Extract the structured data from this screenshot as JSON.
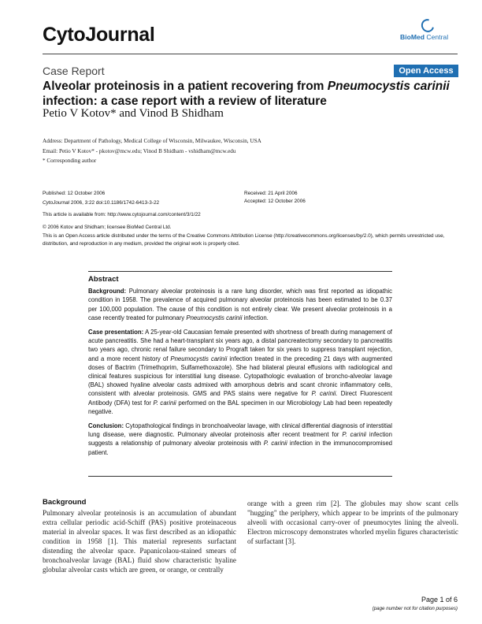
{
  "header": {
    "journal_name": "CytoJournal",
    "publisher_logo": {
      "bold": "BioMed",
      "normal": " Central",
      "icon": "biomed-ring-icon"
    }
  },
  "article": {
    "type": "Case Report",
    "open_access": "Open Access",
    "title_part1": "Alveolar proteinosis in a patient recovering from ",
    "title_italic1": "Pneumocystis carinii",
    "title_part2": " infection: a case report with a review of literature",
    "authors": "Petio V Kotov* and Vinod B Shidham",
    "address": "Address: Department of Pathology, Medical College of Wisconsin, Milwaukee, Wisconsin, USA",
    "email": "Email: Petio V Kotov* - pkotov@mcw.edu; Vinod B Shidham - vshidham@mcw.edu",
    "corresponding": "* Corresponding author"
  },
  "meta": {
    "published": "Published: 12 October 2006",
    "citation_journal": "CytoJournal",
    "citation_rest": " 2006, 3:22    doi:10.1186/1742-6413-3-22",
    "received": "Received: 21 April 2006",
    "accepted": "Accepted: 12 October 2006",
    "available": "This article is available from: http://www.cytojournal.com/content/3/1/22",
    "copyright": "© 2006 Kotov and Shidham; licensee BioMed Central Ltd.",
    "license": "This is an Open Access article distributed under the terms of the Creative Commons Attribution License (http://creativecommons.org/licenses/by/2.0), which permits unrestricted use, distribution, and reproduction in any medium, provided the original work is properly cited."
  },
  "abstract": {
    "heading": "Abstract",
    "background_label": "Background:",
    "background_text": " Pulmonary alveolar proteinosis is a rare lung disorder, which was first reported as idiopathic condition in 1958. The prevalence of acquired pulmonary alveolar proteinosis has been estimated to be 0.37 per 100,000 population. The cause of this condition is not entirely clear. We present alveolar proteinosis in a case recently treated for pulmonary ",
    "background_italic": "Pneumocystis carinii",
    "background_end": " infection.",
    "case_label": "Case presentation:",
    "case_text1": " A 25-year-old Caucasian female presented with shortness of breath during management of acute pancreatitis. She had a heart-transplant six years ago, a distal pancreatectomy secondary to pancreatitis two years ago, chronic renal failure secondary to Prograft taken for six years to suppress transplant rejection, and a more recent history of ",
    "case_italic1": "Pneumocystis carinii",
    "case_text2": " infection treated in the preceding 21 days with augmented doses of Bactrim (Trimethoprim, Sulfamethoxazole). She had bilateral pleural effusions with radiological and clinical features suspicious for interstitial lung disease. Cytopathologic evaluation of broncho-alveolar lavage (BAL) showed hyaline alveolar casts admixed with amorphous debris and scant chronic inflammatory cells, consistent with alveolar proteinosis. GMS and PAS stains were negative for ",
    "case_italic2": "P. carinii.",
    "case_text3": " Direct Fluorescent Antibody (DFA) test for ",
    "case_italic3": "P. carinii",
    "case_text4": " performed on the BAL specimen in our Microbiology Lab had been repeatedly negative.",
    "conclusion_label": "Conclusion:",
    "conclusion_text1": " Cytopathological findings in bronchoalveolar lavage, with clinical differential diagnosis of interstitial lung disease, were diagnostic. Pulmonary alveolar proteinosis after recent treatment for ",
    "conclusion_italic1": "P. carinii",
    "conclusion_text2": " infection suggests a relationship of pulmonary alveolar proteinosis with ",
    "conclusion_italic2": "P. carinii",
    "conclusion_text3": " infection in the immunocompromised patient."
  },
  "body": {
    "background_heading": "Background",
    "left_column": "Pulmonary alveolar proteinosis is an accumulation of abundant extra cellular periodic acid-Schiff (PAS) positive proteinaceous material in alveolar spaces. It was first described as an idiopathic condition in 1958 [1]. This material represents surfactant distending the alveolar space. Papanicolaou-stained smears of bronchoalveolar lavage (BAL) fluid show characteristic hyaline globular alveolar casts which are green, or orange, or centrally",
    "right_column": "orange with a green rim [2]. The globules may show scant cells \"hugging\" the periphery, which appear to be imprints of the pulmonary alveoli with occasional carry-over of pneumocytes lining the alveoli. Electron microscopy demonstrates whorled myelin figures characteristic of surfactant [3]."
  },
  "footer": {
    "page_number": "Page 1 of 6",
    "note": "(page number not for citation purposes)"
  }
}
